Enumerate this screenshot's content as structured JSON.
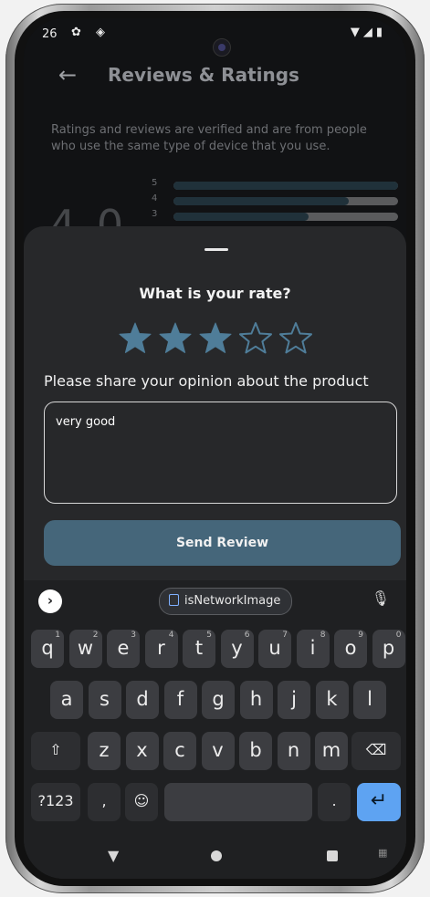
{
  "status_bar": {
    "time": "26",
    "left_icons": "✿ ◈",
    "right_icons": "▼◢▮"
  },
  "app_bar": {
    "back_icon": "←",
    "title": "Reviews & Ratings"
  },
  "description": "Ratings and reviews are verified and are from people who use the same type of device that you use.",
  "rating_summary": {
    "average": "4.0",
    "bars": [
      {
        "label": "5",
        "fraction": 1.0
      },
      {
        "label": "4",
        "fraction": 0.78
      },
      {
        "label": "3",
        "fraction": 0.6
      }
    ]
  },
  "sheet": {
    "title": "What is your rate?",
    "rating": {
      "value": 3,
      "max": 5
    },
    "opinion_label": "Please share your opinion about the product",
    "opinion_text": "very good",
    "send_button": "Send Review"
  },
  "keyboard": {
    "expand_icon": "›",
    "suggestion": "isNetworkImage",
    "mic_icon": "🎙",
    "row1": [
      {
        "k": "q",
        "h": "1"
      },
      {
        "k": "w",
        "h": "2"
      },
      {
        "k": "e",
        "h": "3"
      },
      {
        "k": "r",
        "h": "4"
      },
      {
        "k": "t",
        "h": "5"
      },
      {
        "k": "y",
        "h": "6"
      },
      {
        "k": "u",
        "h": "7"
      },
      {
        "k": "i",
        "h": "8"
      },
      {
        "k": "o",
        "h": "9"
      },
      {
        "k": "p",
        "h": "0"
      }
    ],
    "row2": [
      "a",
      "s",
      "d",
      "f",
      "g",
      "h",
      "j",
      "k",
      "l"
    ],
    "row3": [
      "z",
      "x",
      "c",
      "v",
      "b",
      "n",
      "m"
    ],
    "shift": "⇧",
    "backspace": "⌫",
    "symbols": "?123",
    "comma": ",",
    "emoji": "☺",
    "period": ".",
    "enter": "↵"
  },
  "nav_bar": {
    "back": "▼",
    "keyboard_icon": "▦"
  },
  "colors": {
    "accent": "#45667a",
    "enter_key": "#5ea3f2",
    "star": "#4f7d99"
  }
}
